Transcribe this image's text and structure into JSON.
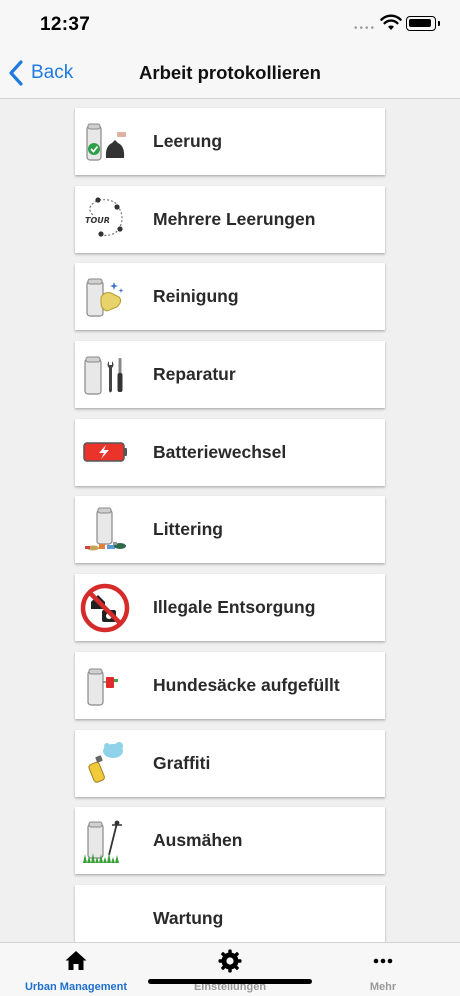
{
  "status": {
    "time": "12:37"
  },
  "nav": {
    "back_label": "Back",
    "title": "Arbeit protokollieren"
  },
  "items": [
    {
      "label": "Leerung",
      "icon": "bin-emptying-icon"
    },
    {
      "label": "Mehrere Leerungen",
      "icon": "tour-route-icon",
      "icon_text": "TOUR"
    },
    {
      "label": "Reinigung",
      "icon": "bin-cleaning-icon"
    },
    {
      "label": "Reparatur",
      "icon": "repair-tools-icon"
    },
    {
      "label": "Batteriewechsel",
      "icon": "battery-icon"
    },
    {
      "label": "Littering",
      "icon": "littering-icon"
    },
    {
      "label": "Illegale Entsorgung",
      "icon": "no-dumping-icon"
    },
    {
      "label": "Hundesäcke aufgefüllt",
      "icon": "dog-bag-icon"
    },
    {
      "label": "Graffiti",
      "icon": "spray-can-icon"
    },
    {
      "label": "Ausmähen",
      "icon": "mowing-icon"
    },
    {
      "label": "Wartung",
      "icon": "maintenance-icon"
    }
  ],
  "tabs": [
    {
      "label": "Urban Management",
      "icon": "home-icon",
      "active": true
    },
    {
      "label": "Einstellungen",
      "icon": "gear-icon",
      "active": false
    },
    {
      "label": "Mehr",
      "icon": "more-icon",
      "active": false
    }
  ],
  "colors": {
    "accent": "#1f7ae0",
    "active_tab": "#1f6fd0",
    "background": "#f0f0f0"
  }
}
